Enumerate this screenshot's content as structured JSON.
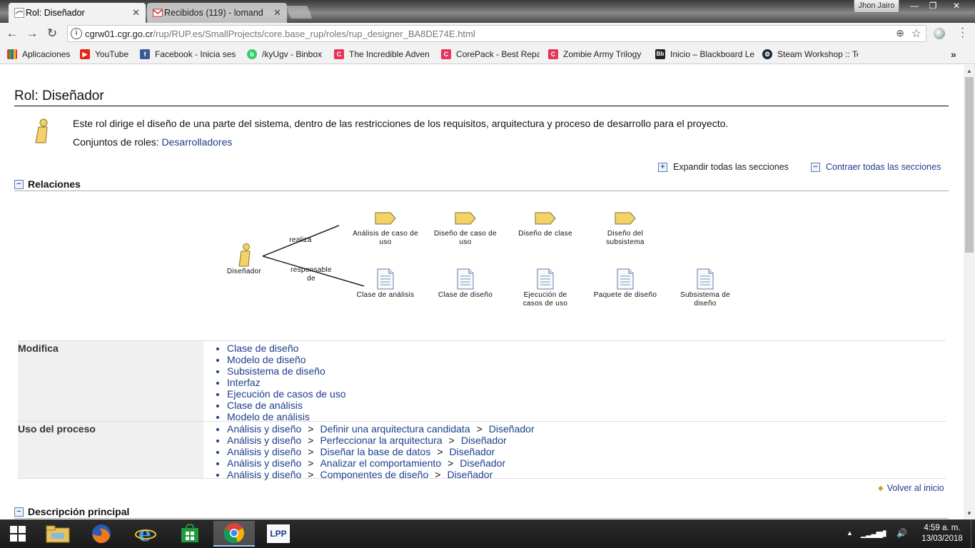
{
  "browser": {
    "tabs": [
      {
        "title": "Rol: Diseñador",
        "active": true
      },
      {
        "title": "Recibidos (119) - lomand",
        "active": false
      }
    ],
    "user": "Jhon Jairo",
    "url_host": "cgrw01.cgr.go.cr",
    "url_path": "/rup/RUP.es/SmallProjects/core.base_rup/roles/rup_designer_BA8DE74E.html",
    "bookmarks": [
      "Aplicaciones",
      "YouTube",
      "Facebook - Inicia ses",
      "/kyUgv - Binbox",
      "The Incredible Adven",
      "CorePack - Best Repa",
      "Zombie Army Trilogy",
      "Inicio – Blackboard Le",
      "Steam Workshop :: Te"
    ]
  },
  "page": {
    "title": "Rol: Diseñador",
    "description": "Este rol dirige el diseño de una parte del sistema, dentro de las restricciones de los requisitos, arquitectura y proceso de desarrollo para el proyecto.",
    "roleset_label": "Conjuntos de roles: ",
    "roleset_link": "Desarrolladores",
    "expand_all": "Expandir todas las secciones",
    "collapse_all": "Contraer todas las secciones",
    "section_relations": "Relaciones",
    "section_main_desc": "Descripción principal",
    "back_to_top": "Volver al inicio"
  },
  "diagram": {
    "role": "Diseñador",
    "edge_performs": "realiza",
    "edge_responsible_1": "responsable",
    "edge_responsible_2": "de",
    "tasks": [
      [
        "Análisis de caso de",
        "uso"
      ],
      [
        "Diseño de caso de",
        "uso"
      ],
      [
        "Diseño de clase",
        ""
      ],
      [
        "Diseño del",
        "subsistema"
      ]
    ],
    "artifacts": [
      [
        "Clase de análisis",
        ""
      ],
      [
        "Clase de diseño",
        ""
      ],
      [
        "Ejecución de",
        "casos de uso"
      ],
      [
        "Paquete de diseño",
        ""
      ],
      [
        "Subsistema de",
        "diseño"
      ]
    ]
  },
  "relations": {
    "modifies_label": "Modifica",
    "modifies": [
      "Clase de diseño",
      "Modelo de diseño",
      "Subsistema de diseño",
      "Interfaz",
      "Ejecución de casos de uso",
      "Clase de análisis",
      "Modelo de análisis"
    ],
    "process_label": "Uso del proceso",
    "process": [
      [
        "Análisis y diseño",
        "Definir una arquitectura candidata",
        "Diseñador"
      ],
      [
        "Análisis y diseño",
        "Perfeccionar la arquitectura",
        "Diseñador"
      ],
      [
        "Análisis y diseño",
        "Diseñar la base de datos",
        "Diseñador"
      ],
      [
        "Análisis y diseño",
        "Analizar el comportamiento",
        "Diseñador"
      ],
      [
        "Análisis y diseño",
        "Componentes de diseño",
        "Diseñador"
      ]
    ],
    "separator": ">"
  },
  "taskbar": {
    "lpp_label": "LPP",
    "time": "4:59 a. m.",
    "date": "13/03/2018"
  },
  "colors": {
    "link": "#1d3f8c",
    "task_fill": "#f4d26a",
    "gmail_red": "#d93025"
  }
}
